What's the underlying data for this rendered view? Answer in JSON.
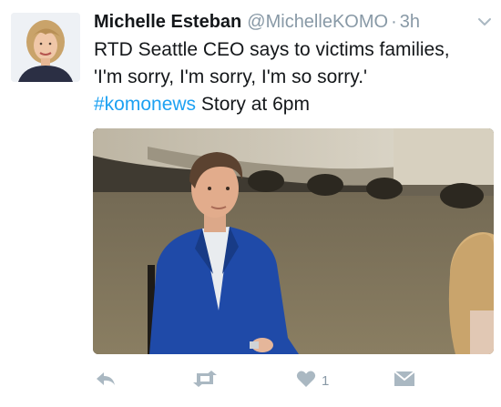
{
  "tweet": {
    "author_name": "Michelle Esteban",
    "handle": "@MichelleKOMO",
    "separator": "·",
    "timestamp": "3h",
    "text_line1": "RTD Seattle CEO says to victims families,",
    "text_line2": "'I'm sorry, I'm sorry, I'm so sorry.'",
    "hashtag": "#komonews",
    "text_tail": " Story at 6pm",
    "avatar_icon": "profile-photo",
    "menu_icon": "chevron-down-icon"
  },
  "actions": {
    "reply_icon": "reply-icon",
    "retweet_icon": "retweet-icon",
    "like_icon": "heart-icon",
    "like_count": "1",
    "dm_icon": "direct-message-icon"
  },
  "colors": {
    "text": "#14171a",
    "muted": "#8899a6",
    "link": "#1da1f2",
    "icon": "#aab8c2"
  }
}
